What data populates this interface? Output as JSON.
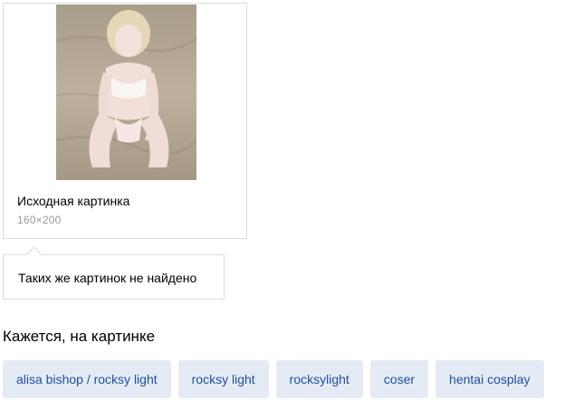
{
  "source_image": {
    "title": "Исходная картинка",
    "size": "160×200"
  },
  "similar": {
    "message": "Таких же картинок не найдено"
  },
  "tags_section": {
    "title": "Кажется, на картинке",
    "tags": [
      "alisa bishop / rocksy light",
      "rocksy light",
      "rocksylight",
      "coser",
      "hentai cosplay"
    ]
  },
  "colors": {
    "tag_background": "#e5ebf5",
    "tag_text": "#1f4fa3",
    "border": "#dcdcdc",
    "muted_text": "#999999"
  }
}
